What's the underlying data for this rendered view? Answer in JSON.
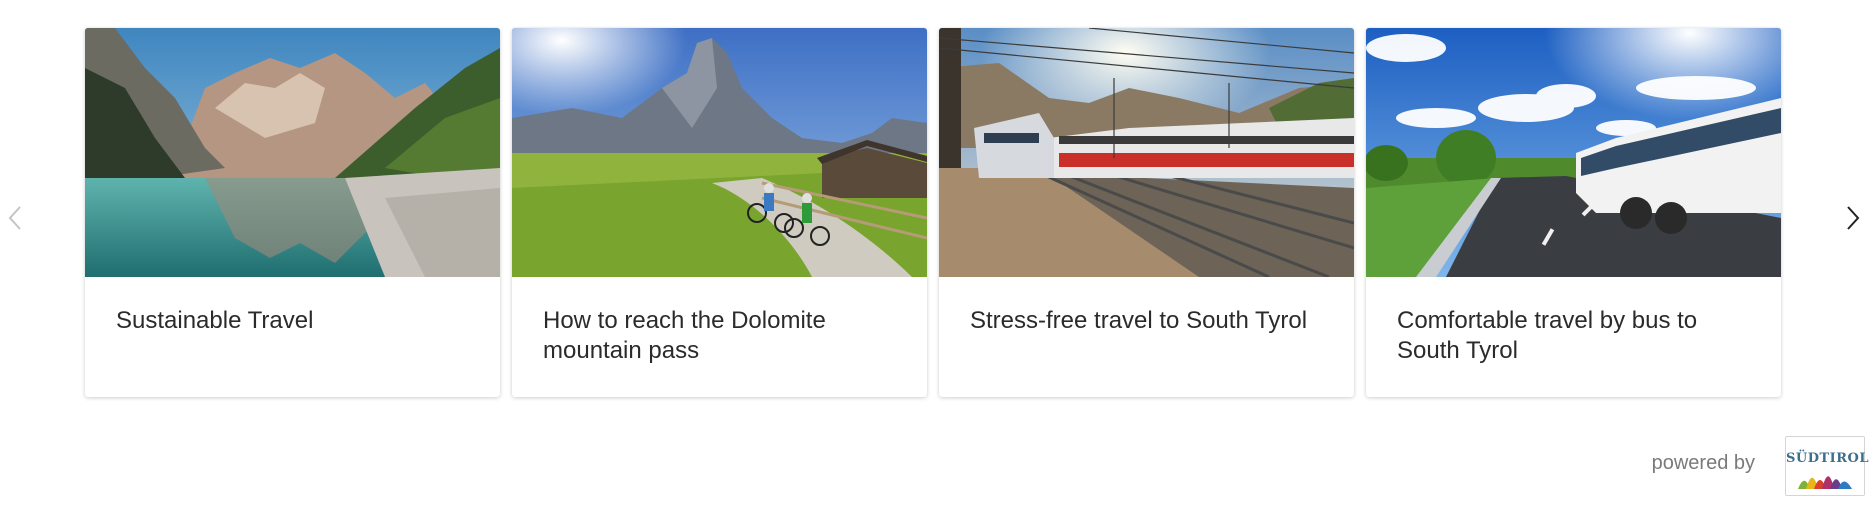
{
  "carousel": {
    "prev_icon": "chevron-left-icon",
    "next_icon": "chevron-right-icon",
    "cards": [
      {
        "title": "Sustainable Travel",
        "image": "alpine-lake-mountains"
      },
      {
        "title": "How to reach the Dolomite mountain pass",
        "image": "cyclists-dolomites-meadow"
      },
      {
        "title": "Stress-free travel to South Tyrol",
        "image": "trains-at-mountain-station"
      },
      {
        "title": "Comfortable travel by bus to South Tyrol",
        "image": "bus-on-country-road"
      }
    ]
  },
  "footer": {
    "powered_by": "powered by",
    "logo_text": "SÜDTIROL"
  },
  "colors": {
    "title_text": "#2b2b2b",
    "powered_text": "#7a7a7a",
    "logo_text": "#3c6e8c"
  }
}
